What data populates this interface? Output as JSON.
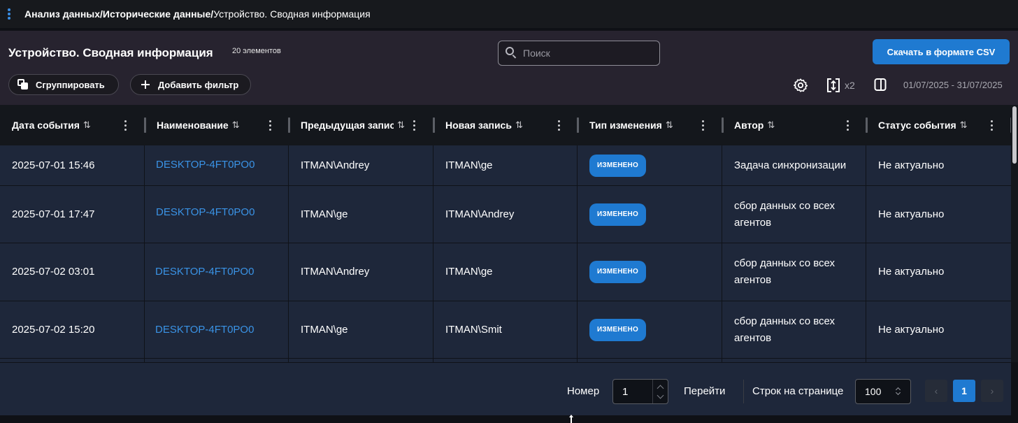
{
  "breadcrumb": {
    "part1": "Анализ данных/",
    "part2": "Исторические данные/",
    "part3": "Устройство. Сводная информация"
  },
  "header": {
    "title": "Устройство. Сводная информация",
    "count": "20 элементов",
    "search_placeholder": "Поиск",
    "csv_button": "Скачать в формате CSV",
    "group_button": "Сгруппировать",
    "filter_button": "Добавить фильтр",
    "zoom": "x2",
    "date_range": "01/07/2025 - 31/07/2025"
  },
  "table": {
    "columns": [
      "Дата события",
      "Наименование",
      "Предыдущая запись",
      "Новая запись",
      "Тип изменения",
      "Автор",
      "Статус события"
    ],
    "sort_glyph": "⇅",
    "rows": [
      {
        "date": "2025-07-01 15:46",
        "name": "DESKTOP-4FT0PO0",
        "prev": "ITMAN\\Andrey",
        "new": "ITMAN\\ge",
        "type": "ИЗМЕНЕНО",
        "author": "Задача синхронизации",
        "status": "Не актуально"
      },
      {
        "date": "2025-07-01 17:47",
        "name": "DESKTOP-4FT0PO0",
        "prev": "ITMAN\\ge",
        "new": "ITMAN\\Andrey",
        "type": "ИЗМЕНЕНО",
        "author": "сбор данных со всех агентов",
        "status": "Не актуально"
      },
      {
        "date": "2025-07-02 03:01",
        "name": "DESKTOP-4FT0PO0",
        "prev": "ITMAN\\Andrey",
        "new": "ITMAN\\ge",
        "type": "ИЗМЕНЕНО",
        "author": "сбор данных со всех агентов",
        "status": "Не актуально"
      },
      {
        "date": "2025-07-02 15:20",
        "name": "DESKTOP-4FT0PO0",
        "prev": "ITMAN\\ge",
        "new": "ITMAN\\Smit",
        "type": "ИЗМЕНЕНО",
        "author": "сбор данных со всех агентов",
        "status": "Не актуально"
      }
    ]
  },
  "footer": {
    "page_label": "Номер",
    "page_value": "1",
    "go_label": "Перейти",
    "rows_label": "Строк на странице",
    "rows_value": "100",
    "current_page": "1",
    "prev_glyph": "‹",
    "next_glyph": "›"
  },
  "colors": {
    "accent": "#1f7ad1",
    "link": "#3a93e6",
    "header_bg": "#27232f",
    "table_bg": "#1e273a"
  },
  "icons": [
    "menu-dots-icon",
    "search-icon",
    "group-icon",
    "plus-icon",
    "gear-icon",
    "resize-icon",
    "panel-icon",
    "sort-icon",
    "kebab-icon",
    "chevron-up-icon",
    "chevron-down-icon"
  ]
}
